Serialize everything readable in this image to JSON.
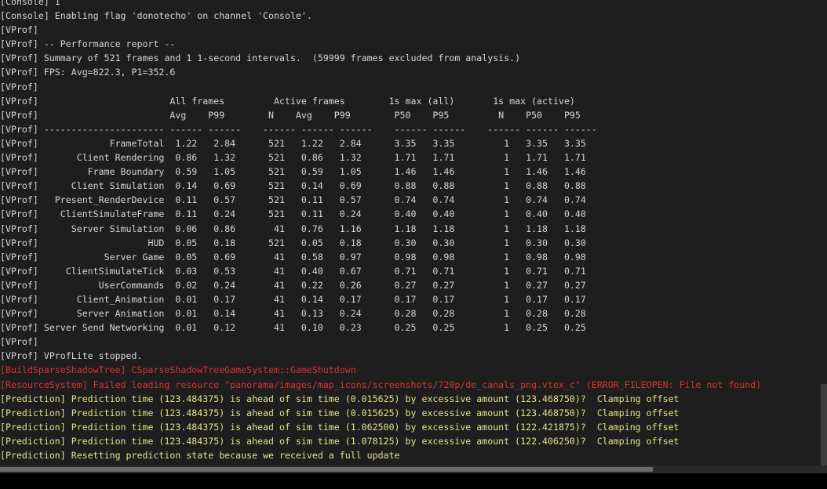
{
  "colors": {
    "background": "#1e1e1e",
    "default_text": "#d6d6d6",
    "error_text": "#d8342d",
    "warning_text": "#e2e28a"
  },
  "lines": [
    {
      "color": "default",
      "text": "[Console] 1"
    },
    {
      "color": "default",
      "text": "[Console] Enabling flag 'donotecho' on channel 'Console'."
    },
    {
      "color": "default",
      "text": "[VProf]"
    },
    {
      "color": "default",
      "text": "[VProf] -- Performance report --"
    },
    {
      "color": "default",
      "text": "[VProf] Summary of 521 frames and 1 1-second intervals.  (59999 frames excluded from analysis.)"
    },
    {
      "color": "default",
      "text": "[VProf] FPS: Avg=822.3, P1=352.6"
    },
    {
      "color": "default",
      "text": "[VProf]"
    },
    {
      "color": "default",
      "text": "[VProf]                        All frames         Active frames        1s max (all)       1s max (active)"
    },
    {
      "color": "default",
      "text": "[VProf]                        Avg    P99        N    Avg    P99        P50    P95         N    P50    P95"
    },
    {
      "color": "default",
      "text": "[VProf] ---------------------- ------ ------    ------ ------ ------    ------ ------    ------ ------ ------"
    },
    {
      "color": "default",
      "text": "[VProf]             FrameTotal  1.22   2.84      521   1.22   2.84      3.35   3.35         1   3.35   3.35"
    },
    {
      "color": "default",
      "text": "[VProf]       Client Rendering  0.86   1.32      521   0.86   1.32      1.71   1.71         1   1.71   1.71"
    },
    {
      "color": "default",
      "text": "[VProf]         Frame Boundary  0.59   1.05      521   0.59   1.05      1.46   1.46         1   1.46   1.46"
    },
    {
      "color": "default",
      "text": "[VProf]      Client Simulation  0.14   0.69      521   0.14   0.69      0.88   0.88         1   0.88   0.88"
    },
    {
      "color": "default",
      "text": "[VProf]   Present_RenderDevice  0.11   0.57      521   0.11   0.57      0.74   0.74         1   0.74   0.74"
    },
    {
      "color": "default",
      "text": "[VProf]    ClientSimulateFrame  0.11   0.24      521   0.11   0.24      0.40   0.40         1   0.40   0.40"
    },
    {
      "color": "default",
      "text": "[VProf]      Server Simulation  0.06   0.86       41   0.76   1.16      1.18   1.18         1   1.18   1.18"
    },
    {
      "color": "default",
      "text": "[VProf]                    HUD  0.05   0.18      521   0.05   0.18      0.30   0.30         1   0.30   0.30"
    },
    {
      "color": "default",
      "text": "[VProf]            Server Game  0.05   0.69       41   0.58   0.97      0.98   0.98         1   0.98   0.98"
    },
    {
      "color": "default",
      "text": "[VProf]     ClientSimulateTick  0.03   0.53       41   0.40   0.67      0.71   0.71         1   0.71   0.71"
    },
    {
      "color": "default",
      "text": "[VProf]           UserCommands  0.02   0.24       41   0.22   0.26      0.27   0.27         1   0.27   0.27"
    },
    {
      "color": "default",
      "text": "[VProf]       Client_Animation  0.01   0.17       41   0.14   0.17      0.17   0.17         1   0.17   0.17"
    },
    {
      "color": "default",
      "text": "[VProf]       Server Animation  0.01   0.14       41   0.13   0.24      0.28   0.28         1   0.28   0.28"
    },
    {
      "color": "default",
      "text": "[VProf] Server Send Networking  0.01   0.12       41   0.10   0.23      0.25   0.25         1   0.25   0.25"
    },
    {
      "color": "default",
      "text": "[VProf]"
    },
    {
      "color": "default",
      "text": "[VProf] VProfLite stopped."
    },
    {
      "color": "red",
      "text": "[BuildSparseShadowTree] CSparseShadowTreeGameSystem::GameShutdown"
    },
    {
      "color": "red",
      "text": "[ResourceSystem] Failed loading resource \"panorama/images/map_icons/screenshots/720p/de_canals_png.vtex_c\" (ERROR_FILEOPEN: File not found)"
    },
    {
      "color": "yellow",
      "text": "[Prediction] Prediction time (123.484375) is ahead of sim time (0.015625) by excessive amount (123.468750)?  Clamping offset"
    },
    {
      "color": "yellow",
      "text": "[Prediction] Prediction time (123.484375) is ahead of sim time (0.015625) by excessive amount (123.468750)?  Clamping offset"
    },
    {
      "color": "yellow",
      "text": "[Prediction] Prediction time (123.484375) is ahead of sim time (1.062500) by excessive amount (122.421875)?  Clamping offset"
    },
    {
      "color": "yellow",
      "text": "[Prediction] Prediction time (123.484375) is ahead of sim time (1.078125) by excessive amount (122.406250)?  Clamping offset"
    },
    {
      "color": "yellow",
      "text": "[Prediction] Resetting prediction state because we received a full update"
    }
  ]
}
